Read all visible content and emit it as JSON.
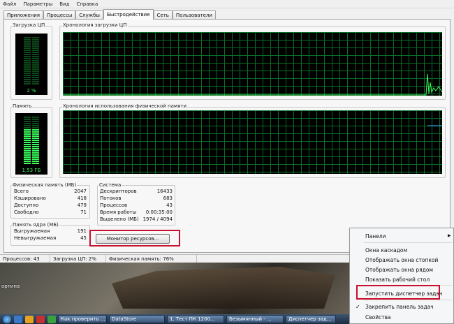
{
  "menu": [
    "Файл",
    "Параметры",
    "Вид",
    "Справка"
  ],
  "tabs": [
    "Приложения",
    "Процессы",
    "Службы",
    "Быстродействие",
    "Сеть",
    "Пользователи"
  ],
  "active_tab": 3,
  "cpu": {
    "label": "Загрузка ЦП",
    "value": "2 %",
    "level": 0.02,
    "history_label": "Хронология загрузки ЦП"
  },
  "memory": {
    "label": "Память",
    "value": "1,53 ГБ",
    "level": 0.76,
    "history_label": "Хронология использования физической памяти"
  },
  "physical_memory": {
    "title": "Физическая память (МБ)",
    "rows": [
      {
        "label": "Всего",
        "value": "2047"
      },
      {
        "label": "Кэшировано",
        "value": "418"
      },
      {
        "label": "Доступно",
        "value": "479"
      },
      {
        "label": "Свободно",
        "value": "71"
      }
    ]
  },
  "kernel_memory": {
    "title": "Память ядра (МБ)",
    "rows": [
      {
        "label": "Выгружаемая",
        "value": "191"
      },
      {
        "label": "Невыгружаемая",
        "value": "45"
      }
    ]
  },
  "system": {
    "title": "Система",
    "rows": [
      {
        "label": "Дескрипторов",
        "value": "16433"
      },
      {
        "label": "Потоков",
        "value": "683"
      },
      {
        "label": "Процессов",
        "value": "43"
      },
      {
        "label": "Время работы",
        "value": "0:00:35:00"
      },
      {
        "label": "Выделено (МБ)",
        "value": "1974 / 4094"
      }
    ]
  },
  "monitor_button": "Монитор ресурсов...",
  "statusbar": {
    "processes": "Процессов: 43",
    "cpu": "Загрузка ЦП: 2%",
    "memory": "Физическая память: 76%"
  },
  "desktop_icon_label": "ортина",
  "taskbar": {
    "items": [
      "Как проверить ...",
      "DataStore",
      "1. Тест ПК 1200...",
      "Безымянный - ...",
      "Диспетчер зад..."
    ]
  },
  "context_menu": {
    "items": [
      "Панели",
      "Окна каскадом",
      "Отображать окна стопкой",
      "Отображать окна рядом",
      "Показать рабочий стол",
      "Запустить диспетчер задач",
      "Закрепить панель задач",
      "Свойства"
    ]
  },
  "colors": {
    "graph_bg": "#000000",
    "grid": "#0b7a2a",
    "meter_fill": "#39ff5a",
    "cpu_line": "#39ff5a",
    "mem_line": "#3aa8ff",
    "highlight": "#c8102e"
  }
}
